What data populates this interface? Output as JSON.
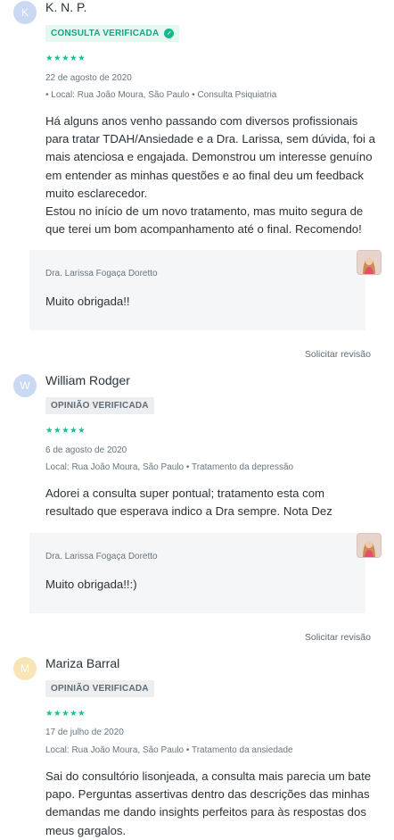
{
  "reviews": [
    {
      "initial": "K",
      "avatar_color": "#c9d8f3",
      "author": "K. N. P.",
      "badge": "CONSULTA VERIFICADA",
      "badge_style": "green",
      "badge_icon": "check-circle-icon",
      "rating": 5,
      "date": "22 de agosto de 2020",
      "meta": "• Local: Rua João Moura, São Paulo • Consulta Psiquiatria",
      "text": "Há alguns anos venho passando com diversos profissionais para tratar TDAH/Ansiedade e a Dra. Larissa, sem dúvida, foi a mais atenciosa e engajada. Demonstrou um interesse genuíno em entender as minhas questões e ao final deu um feedback muito esclarecedor.\nEstou no início de um novo tratamento, mas muito segura de que terei um bom acompanhamento até o final. Recomendo!",
      "reply_author": "Dra. Larissa Fogaça Doretto",
      "reply_text": "Muito obrigada!!",
      "action": "Solicitar revisão"
    },
    {
      "initial": "W",
      "avatar_color": "#c9d8f3",
      "author": "William Rodger",
      "badge": "OPINIÃO VERIFICADA",
      "badge_style": "gray",
      "rating": 5,
      "date": "6 de agosto de 2020",
      "meta": "Local: Rua João Moura, São Paulo • Tratamento da depressão",
      "text": "Adorei a consulta super pontual; tratamento esta com resultado que esperava indico a Dra sempre. Nota Dez",
      "reply_author": "Dra. Larissa Fogaça Doretto",
      "reply_text": "Muito obrigada!!:)",
      "action": "Solicitar revisão"
    },
    {
      "initial": "M",
      "avatar_color": "#f8e4b4",
      "author": "Mariza Barral",
      "badge": "OPINIÃO VERIFICADA",
      "badge_style": "gray",
      "rating": 5,
      "date": "17 de julho de 2020",
      "meta": "Local: Rua João Moura, São Paulo • Tratamento da ansiedade",
      "text": "Sai do consultório lisonjeada, a consulta mais parecia um bate papo. Perguntas assertivas dentro das descrições das minhas demandas me dando insights perfeitos para às respostas dos meus gargalos."
    }
  ]
}
